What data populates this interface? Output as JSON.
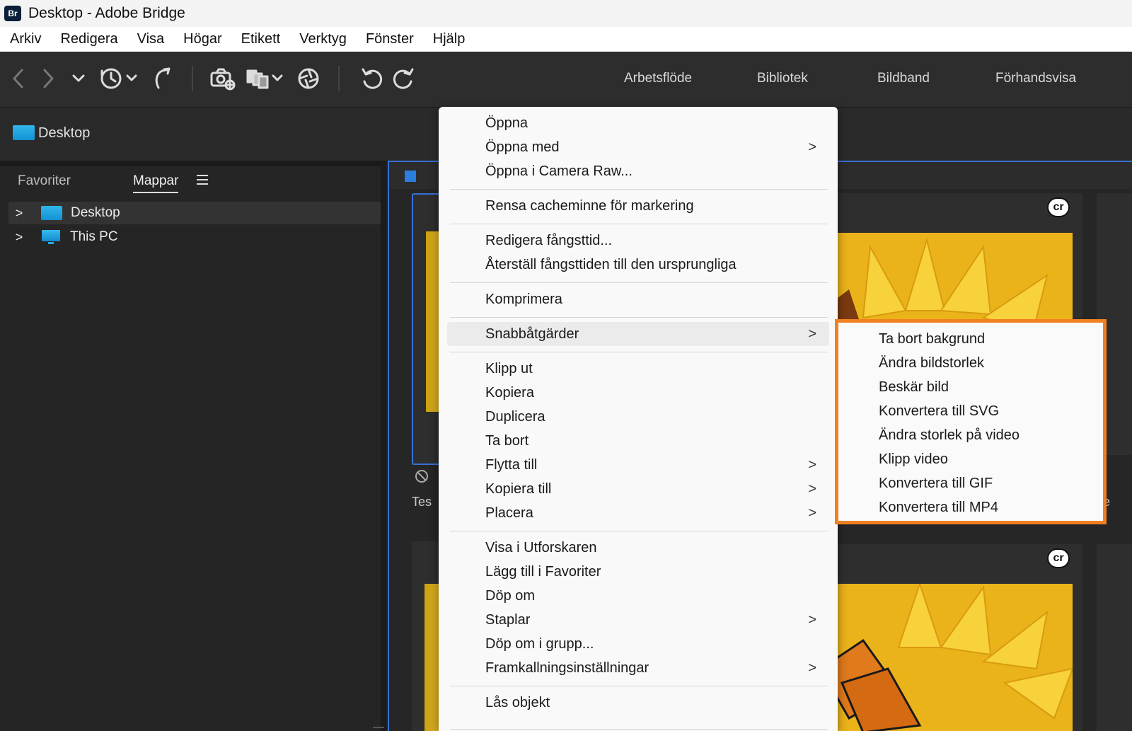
{
  "window": {
    "logo_text": "Br",
    "title": "Desktop - Adobe Bridge"
  },
  "menubar": {
    "items": [
      "Arkiv",
      "Redigera",
      "Visa",
      "Högar",
      "Etikett",
      "Verktyg",
      "Fönster",
      "Hjälp"
    ]
  },
  "toolbar": {
    "workspaces": [
      "Arbetsflöde",
      "Bibliotek",
      "Bildband",
      "Förhandsvisa"
    ]
  },
  "pathbar": {
    "current": "Desktop"
  },
  "leftpanel": {
    "tabs": {
      "favorites": "Favoriter",
      "folders": "Mappar"
    },
    "tree": [
      "Desktop",
      "This PC"
    ]
  },
  "content": {
    "badge": "cr",
    "caption_fragments": [
      "Tes",
      "Te"
    ]
  },
  "context_menu": {
    "items": [
      {
        "label": "Öppna",
        "submenu": false
      },
      {
        "label": "Öppna med",
        "submenu": true
      },
      {
        "label": "Öppna i Camera Raw...",
        "submenu": false
      },
      {
        "label": "Rensa cacheminne för markering",
        "submenu": false
      },
      {
        "label": "Redigera fångsttid...",
        "submenu": false
      },
      {
        "label": "Återställ fångsttiden till den ursprungliga",
        "submenu": false
      },
      {
        "label": "Komprimera",
        "submenu": false
      },
      {
        "label": "Snabbåtgärder",
        "submenu": true
      },
      {
        "label": "Klipp ut",
        "submenu": false
      },
      {
        "label": "Kopiera",
        "submenu": false
      },
      {
        "label": "Duplicera",
        "submenu": false
      },
      {
        "label": "Ta bort",
        "submenu": false
      },
      {
        "label": "Flytta till",
        "submenu": true
      },
      {
        "label": "Kopiera till",
        "submenu": true
      },
      {
        "label": "Placera",
        "submenu": true
      },
      {
        "label": "Visa i Utforskaren",
        "submenu": false
      },
      {
        "label": "Lägg till i Favoriter",
        "submenu": false
      },
      {
        "label": "Döp om",
        "submenu": false
      },
      {
        "label": "Staplar",
        "submenu": true
      },
      {
        "label": "Döp om i grupp...",
        "submenu": false
      },
      {
        "label": "Framkallningsinställningar",
        "submenu": true
      },
      {
        "label": "Lås objekt",
        "submenu": false
      }
    ],
    "arrow_glyph": ">"
  },
  "submenu": {
    "highlight_color": "#f08022",
    "items": [
      "Ta bort bakgrund",
      "Ändra bildstorlek",
      "Beskär bild",
      "Konvertera till SVG",
      "Ändra storlek på video",
      "Klipp video",
      "Konvertera till GIF",
      "Konvertera till MP4"
    ]
  },
  "colors": {
    "accent_blue": "#2b7de0",
    "menu_bg": "#f9f9f9",
    "toolbar_bg": "#2d2d2d"
  }
}
